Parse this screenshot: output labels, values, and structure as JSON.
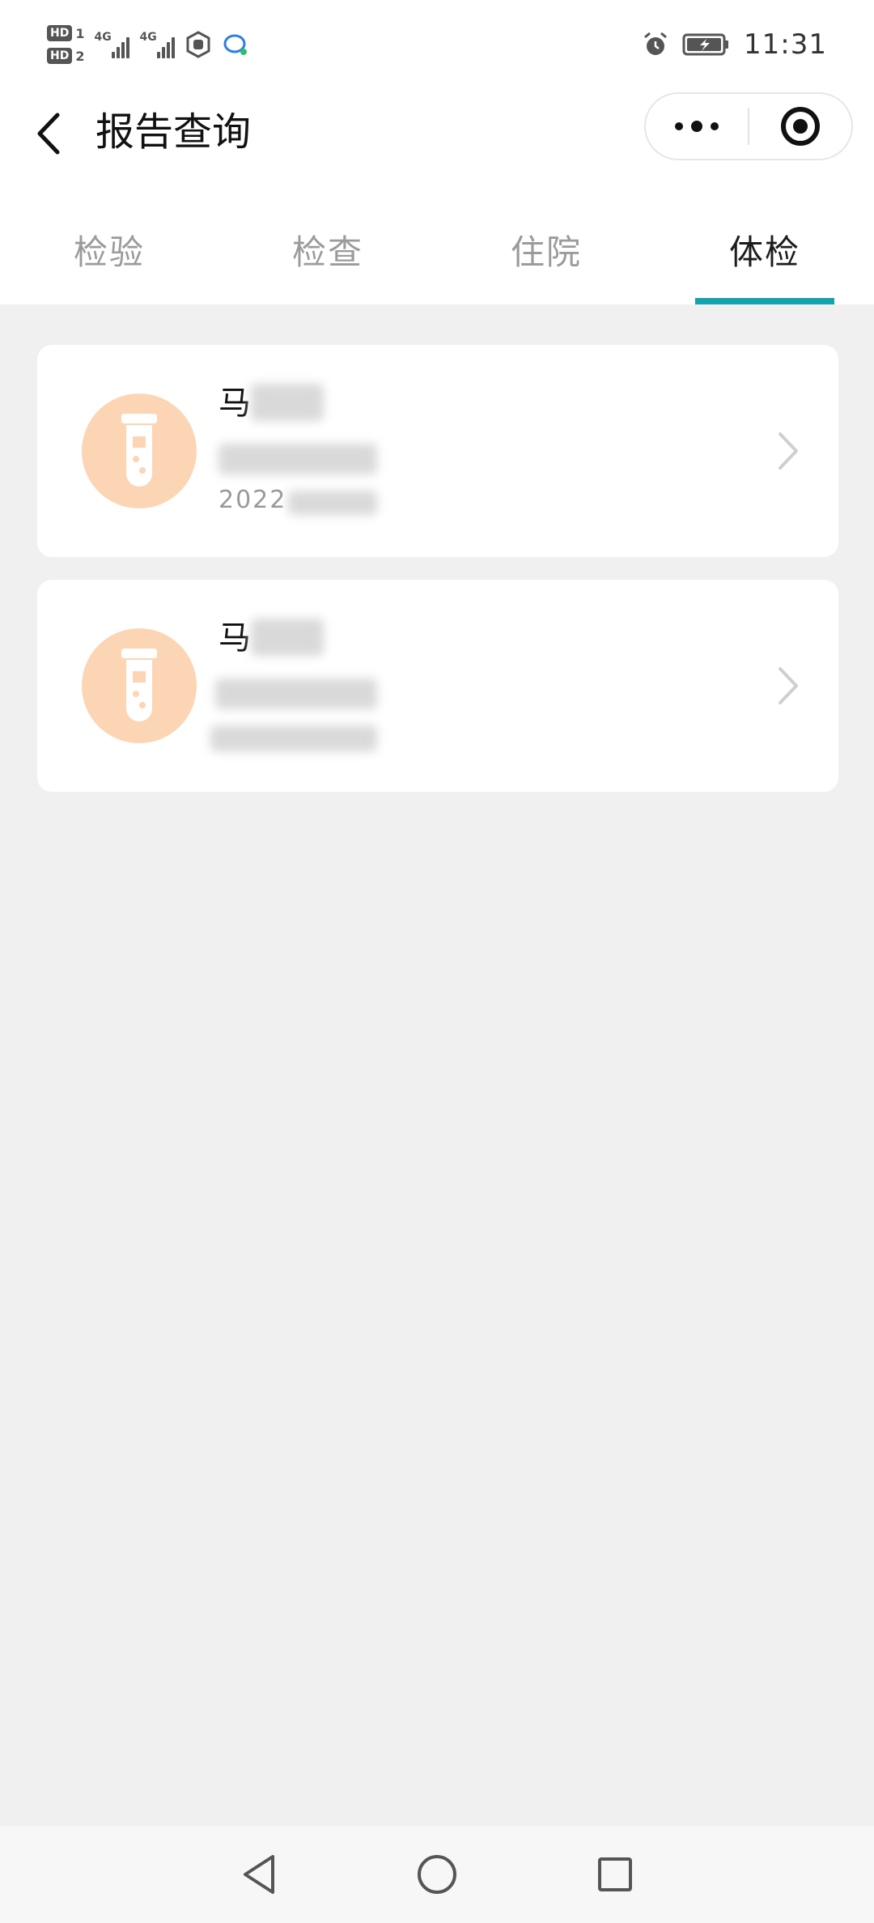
{
  "status_bar": {
    "time": "11:31",
    "sim1_label": "HD",
    "sim1_num": "1",
    "sim2_label": "HD",
    "sim2_num": "2",
    "network1": "4G",
    "network2": "4G"
  },
  "header": {
    "title": "报告查询"
  },
  "tabs": [
    {
      "label": "检验",
      "active": false
    },
    {
      "label": "检查",
      "active": false
    },
    {
      "label": "住院",
      "active": false
    },
    {
      "label": "体检",
      "active": true
    }
  ],
  "records": [
    {
      "name": "马",
      "date": "2022"
    },
    {
      "name": "马",
      "date": ""
    }
  ],
  "colors": {
    "accent": "#14a3ad",
    "avatar_bg": "#fcd5b4",
    "avatar_icon": "#ffffff",
    "background": "#f0f0f0"
  },
  "icons": {
    "card_icon": "test-tube-icon",
    "back": "chevron-left-icon",
    "more": "more-dots-icon",
    "close": "target-icon"
  }
}
